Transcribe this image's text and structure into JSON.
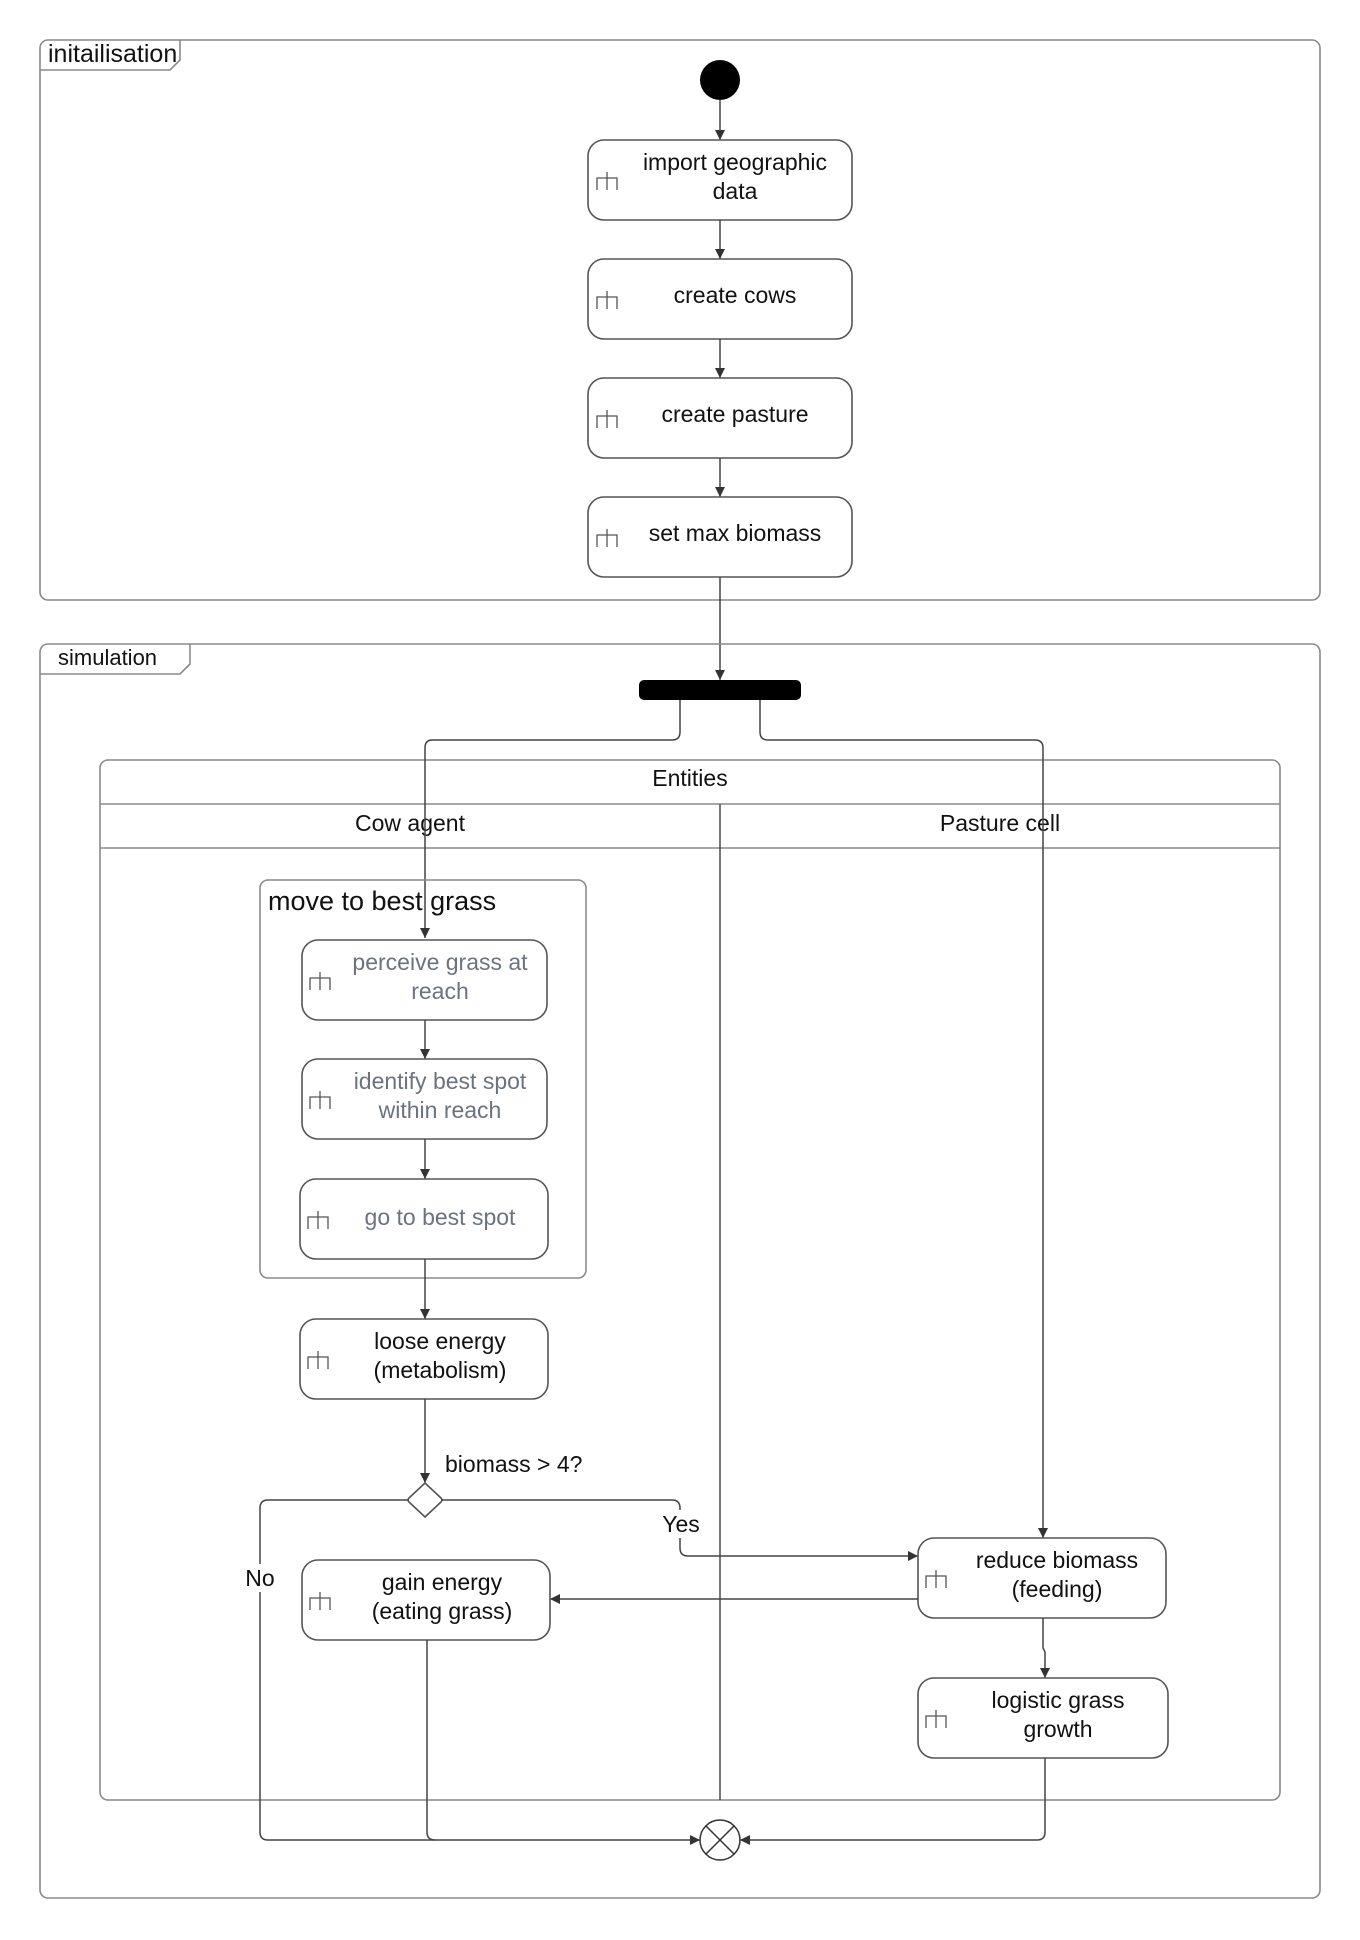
{
  "frames": {
    "initialisation": "initailisation",
    "simulation": "simulation"
  },
  "init_actions": [
    {
      "line1": "import geographic",
      "line2": "data"
    },
    {
      "line1": "create cows",
      "line2": ""
    },
    {
      "line1": "create pasture",
      "line2": ""
    },
    {
      "line1": "set max biomass",
      "line2": ""
    }
  ],
  "swimlanes": {
    "title": "Entities",
    "lanes": [
      "Cow agent",
      "Pasture cell"
    ]
  },
  "group": {
    "title": "move to best grass",
    "actions": [
      {
        "line1": "perceive grass at",
        "line2": "reach"
      },
      {
        "line1": "identify best spot",
        "line2": "within reach"
      },
      {
        "line1": "go to best spot",
        "line2": ""
      }
    ]
  },
  "cow_actions": {
    "loose": {
      "line1": "loose energy",
      "line2": "(metabolism)"
    },
    "gain": {
      "line1": "gain energy",
      "line2": "(eating grass)"
    }
  },
  "decision": {
    "label": "biomass > 4?",
    "yes": "Yes",
    "no": "No"
  },
  "pasture_actions": {
    "reduce": {
      "line1": "reduce biomass",
      "line2": "(feeding)"
    },
    "growth": {
      "line1": "logistic grass",
      "line2": "growth"
    }
  },
  "icons": {
    "action": "rake-icon",
    "start": "initial-node-icon",
    "fork": "fork-bar-icon",
    "end": "flow-final-icon"
  }
}
